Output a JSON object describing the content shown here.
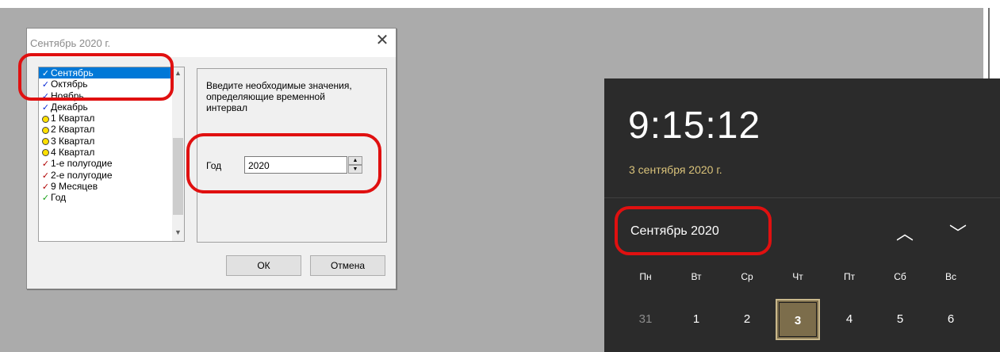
{
  "dialog": {
    "title": "Сентябрь 2020 г.",
    "list_items": [
      {
        "label": "Сентябрь",
        "marker": "check-blue",
        "selected": true
      },
      {
        "label": "Октябрь",
        "marker": "check-blue",
        "selected": false
      },
      {
        "label": "Ноябрь",
        "marker": "check-blue",
        "selected": false
      },
      {
        "label": "Декабрь",
        "marker": "check-blue",
        "selected": false
      },
      {
        "label": "1 Квартал",
        "marker": "dot-yellow",
        "selected": false
      },
      {
        "label": "2 Квартал",
        "marker": "dot-yellow",
        "selected": false
      },
      {
        "label": "3 Квартал",
        "marker": "dot-yellow",
        "selected": false
      },
      {
        "label": "4 Квартал",
        "marker": "dot-yellow",
        "selected": false
      },
      {
        "label": "1-е полугодие",
        "marker": "check-red",
        "selected": false
      },
      {
        "label": "2-е полугодие",
        "marker": "check-red",
        "selected": false
      },
      {
        "label": "9 Месяцев",
        "marker": "check-red",
        "selected": false
      },
      {
        "label": "Год",
        "marker": "check-green",
        "selected": false
      }
    ],
    "prompt": "Введите необходимые значения, определяющие временной интервал",
    "year_label": "Год",
    "year_value": "2020",
    "ok_label": "ОК",
    "cancel_label": "Отмена"
  },
  "flyout": {
    "time": "9:15:12",
    "date": "3 сентября 2020 г.",
    "month_label": "Сентябрь 2020",
    "weekdays": [
      "Пн",
      "Вт",
      "Ср",
      "Чт",
      "Пт",
      "Сб",
      "Вс"
    ],
    "days": [
      {
        "label": "31",
        "muted": true,
        "today": false
      },
      {
        "label": "1",
        "muted": false,
        "today": false
      },
      {
        "label": "2",
        "muted": false,
        "today": false
      },
      {
        "label": "3",
        "muted": false,
        "today": true
      },
      {
        "label": "4",
        "muted": false,
        "today": false
      },
      {
        "label": "5",
        "muted": false,
        "today": false
      },
      {
        "label": "6",
        "muted": false,
        "today": false
      }
    ]
  },
  "colors": {
    "highlight": "#e01010",
    "today_fill": "#7c6d4b",
    "date_accent": "#d9c27a",
    "selection": "#0078d7"
  },
  "icons": [
    "close-icon",
    "check-icon",
    "yellow-dot-icon",
    "scroll-up-arrow-icon",
    "scroll-down-arrow-icon",
    "spin-up-icon",
    "spin-down-icon",
    "chevron-up-icon",
    "chevron-down-icon"
  ]
}
